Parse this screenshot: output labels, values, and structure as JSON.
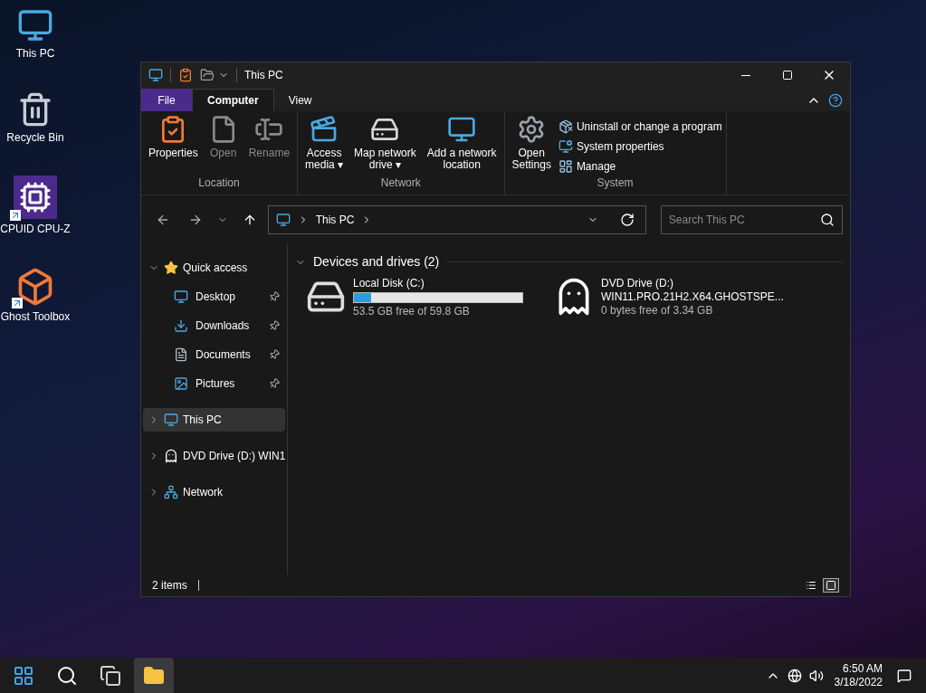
{
  "desktop_icons": [
    {
      "label": "This PC",
      "shortcut": false
    },
    {
      "label": "Recycle Bin",
      "shortcut": false
    },
    {
      "label": "CPUID CPU-Z",
      "shortcut": true
    },
    {
      "label": "Ghost Toolbox",
      "shortcut": true
    }
  ],
  "window": {
    "title": "This PC",
    "tabs": [
      {
        "label": "File",
        "kind": "file",
        "selected": false
      },
      {
        "label": "Computer",
        "kind": "tab",
        "selected": true
      },
      {
        "label": "View",
        "kind": "tab",
        "selected": false
      }
    ],
    "ribbon_groups": [
      {
        "label": "Location",
        "items": [
          {
            "kind": "large",
            "label": "Properties",
            "disabled": false
          },
          {
            "kind": "large",
            "label": "Open",
            "disabled": true
          },
          {
            "kind": "large",
            "label": "Rename",
            "disabled": true
          }
        ]
      },
      {
        "label": "Network",
        "items": [
          {
            "kind": "large",
            "label": "Access\nmedia",
            "caret": "▾",
            "disabled": false
          },
          {
            "kind": "large",
            "label": "Map network\ndrive",
            "caret": "▾",
            "disabled": false
          },
          {
            "kind": "large",
            "label": "Add a network\nlocation",
            "disabled": false
          }
        ]
      },
      {
        "label": "System",
        "items": [
          {
            "kind": "large",
            "label": "Open\nSettings",
            "disabled": false
          },
          {
            "kind": "small",
            "label": "Uninstall or change a program",
            "disabled": false
          },
          {
            "kind": "small",
            "label": "System properties",
            "disabled": false
          },
          {
            "kind": "small",
            "label": "Manage",
            "disabled": false
          }
        ]
      }
    ],
    "address": [
      "This PC"
    ],
    "search": {
      "placeholder": "Search This PC"
    },
    "sidebar": [
      {
        "label": "Quick access",
        "expanded": true,
        "selected": false,
        "children": [
          {
            "label": "Desktop",
            "pinned": true,
            "selected": false
          },
          {
            "label": "Downloads",
            "pinned": true,
            "selected": false
          },
          {
            "label": "Documents",
            "pinned": true,
            "selected": false
          },
          {
            "label": "Pictures",
            "pinned": true,
            "selected": false
          }
        ]
      },
      {
        "label": "This PC",
        "expanded": false,
        "selected": true
      },
      {
        "label": "DVD Drive (D:) WIN1",
        "expanded": false,
        "selected": false
      },
      {
        "label": "Network",
        "expanded": false,
        "selected": false
      }
    ],
    "sections": [
      {
        "title": "Devices and drives (2)",
        "expanded": true,
        "drives": [
          {
            "kind": "disk",
            "name": "Local Disk (C:)",
            "level": 0.1,
            "free": "53.5 GB free of 59.8 GB"
          },
          {
            "kind": "dvd",
            "name": "DVD Drive (D:)",
            "label": "WIN11.PRO.21H2.X64.GHOSTSPE...",
            "free": "0 bytes free of 3.34 GB"
          }
        ]
      }
    ],
    "status_bar": {
      "text": "2 items",
      "views": [
        {
          "kind": "details",
          "selected": false
        },
        {
          "kind": "tiles",
          "selected": true
        }
      ]
    }
  },
  "taskbar": {
    "apps": [
      {
        "kind": "start",
        "active": false
      },
      {
        "kind": "search",
        "active": false
      },
      {
        "kind": "taskview",
        "active": false
      },
      {
        "kind": "explorer",
        "active": true
      }
    ],
    "time": "6:50 AM",
    "date": "3/18/2022"
  }
}
